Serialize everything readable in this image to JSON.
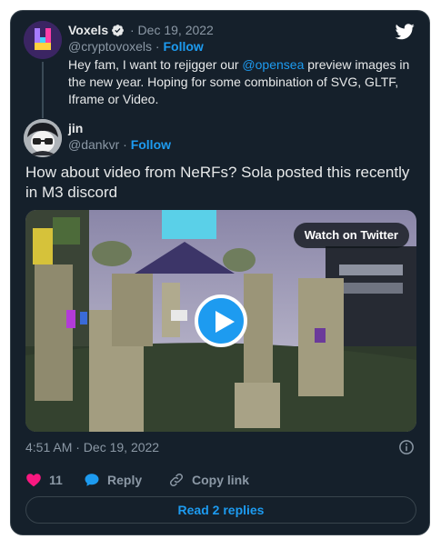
{
  "quoted_tweet": {
    "name": "Voxels",
    "date": "· Dec 19, 2022",
    "handle": "@cryptovoxels",
    "follow_separator": "·",
    "follow_label": "Follow",
    "text_before_mention": "Hey fam, I want to rejigger our ",
    "mention": "@opensea",
    "text_after_mention": " preview images in the new year. Hoping for some combination of SVG, GLTF, Iframe or Video."
  },
  "reply_author": {
    "name": "jin",
    "handle": "@dankvr",
    "follow_separator": "·",
    "follow_label": "Follow"
  },
  "tweet": {
    "text": "How about video from NeRFs? Sola posted this recently in M3 discord"
  },
  "media": {
    "watch_label": "Watch on Twitter"
  },
  "meta": {
    "timestamp": "4:51 AM · Dec 19, 2022"
  },
  "actions": {
    "like_count": "11",
    "reply_label": "Reply",
    "copy_link_label": "Copy link"
  },
  "footer": {
    "read_replies_label": "Read 2 replies"
  },
  "icons": {
    "brand": "twitter-bird-icon",
    "verified": "verified-badge-icon",
    "info": "info-icon",
    "like": "heart-icon",
    "reply": "speech-bubble-icon",
    "copy_link": "link-icon",
    "play": "play-icon"
  },
  "colors": {
    "card_background": "#15202b",
    "border": "#38444d",
    "accent": "#1d9bf0",
    "muted_text": "#8b98a5",
    "like": "#f91880"
  }
}
